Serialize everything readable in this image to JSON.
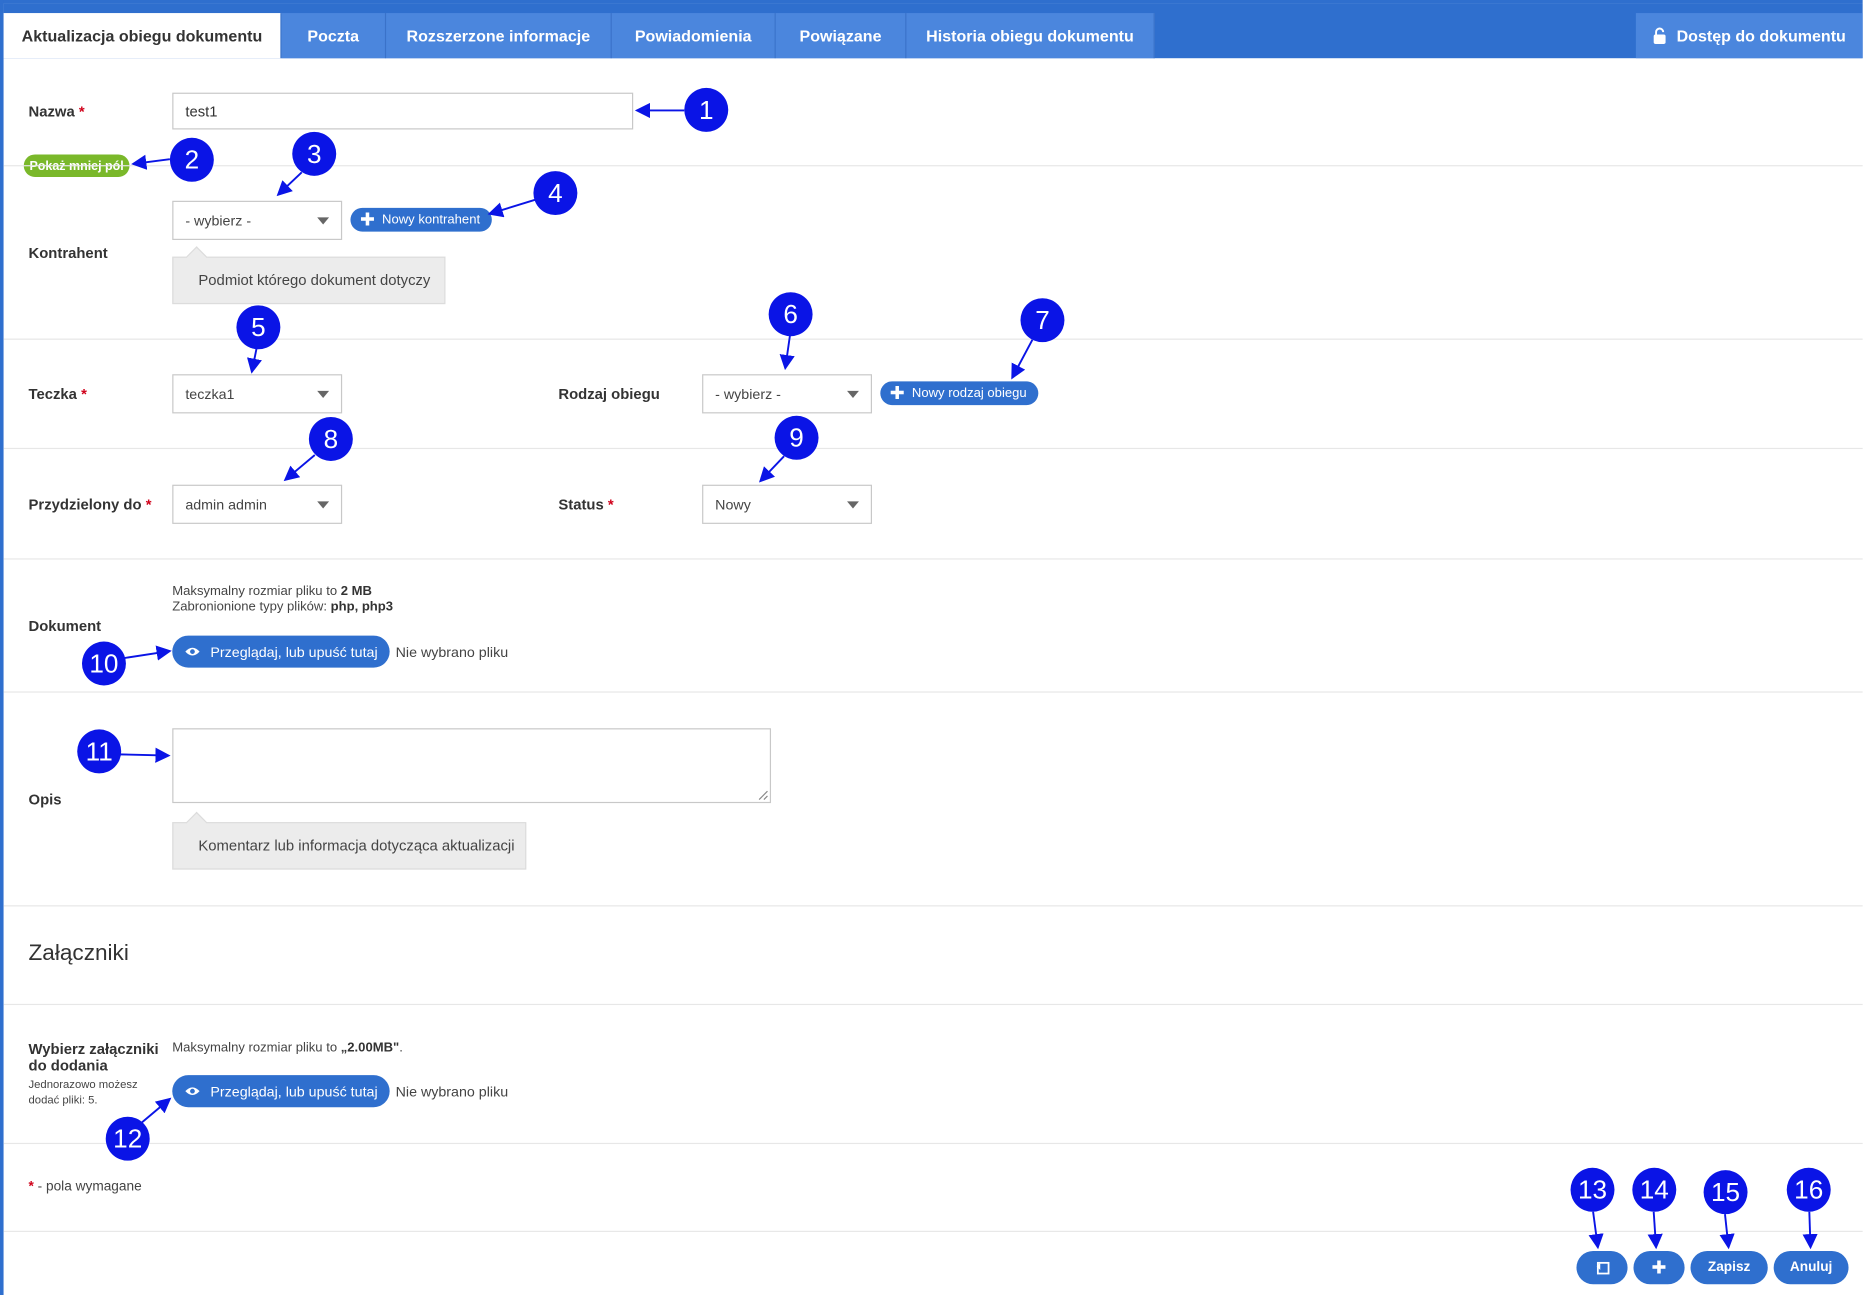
{
  "tabs": [
    {
      "label": "Aktualizacja obiegu dokumentu",
      "active": true
    },
    {
      "label": "Poczta"
    },
    {
      "label": "Rozszerzone informacje"
    },
    {
      "label": "Powiadomienia"
    },
    {
      "label": "Powiązane"
    },
    {
      "label": "Historia obiegu dokumentu"
    }
  ],
  "access_button": {
    "label": "Dostęp do dokumentu",
    "icon": "unlock-icon"
  },
  "required_mark": "*",
  "nazwa": {
    "label": "Nazwa",
    "value": "test1"
  },
  "toggle_fields": {
    "label": "Pokaż mniej pól"
  },
  "kontrahent": {
    "label": "Kontrahent",
    "selected": "- wybierz -",
    "new_button": "Nowy kontrahent",
    "hint": "Podmiot którego dokument dotyczy"
  },
  "teczka": {
    "label": "Teczka",
    "selected": "teczka1"
  },
  "rodzaj_obiegu": {
    "label": "Rodzaj obiegu",
    "selected": "- wybierz -",
    "new_button": "Nowy rodzaj obiegu"
  },
  "przydzielony": {
    "label": "Przydzielony do",
    "selected": "admin admin"
  },
  "status": {
    "label": "Status",
    "selected": "Nowy"
  },
  "dokument": {
    "label": "Dokument",
    "max_size_prefix": "Maksymalny rozmiar pliku to ",
    "max_size_value": "2 MB",
    "forbidden_prefix": "Zabronionione typy plików: ",
    "forbidden_value": "php, php3",
    "browse": "Przeglądaj, lub upuść tutaj",
    "no_file": "Nie wybrano pliku"
  },
  "opis": {
    "label": "Opis",
    "value": "",
    "hint": "Komentarz lub informacja dotycząca aktualizacji"
  },
  "zalaczniki": {
    "title": "Załączniki",
    "label_line1": "Wybierz załączniki",
    "label_line2": "do dodania",
    "sub_line1": "Jednorazowo możesz",
    "sub_line2": "dodać pliki: 5.",
    "max_size_prefix": "Maksymalny rozmiar pliku to ",
    "max_size_value": "„2.00MB\"",
    "max_size_suffix": ".",
    "browse": "Przeglądaj, lub upuść tutaj",
    "no_file": "Nie wybrano pliku"
  },
  "required_note": "- pola wymagane",
  "footer": {
    "save_label": "Zapisz",
    "cancel_label": "Anuluj",
    "back_icon": "back-list-icon",
    "add_icon": "plus-icon"
  },
  "markers": [
    "1",
    "2",
    "3",
    "4",
    "5",
    "6",
    "7",
    "8",
    "9",
    "10",
    "11",
    "12",
    "13",
    "14",
    "15",
    "16"
  ],
  "colors": {
    "primary": "#2f6fce",
    "tab": "#4b86dd",
    "green": "#7ab82a",
    "marker": "#0a14e6",
    "required": "#d0021b"
  }
}
